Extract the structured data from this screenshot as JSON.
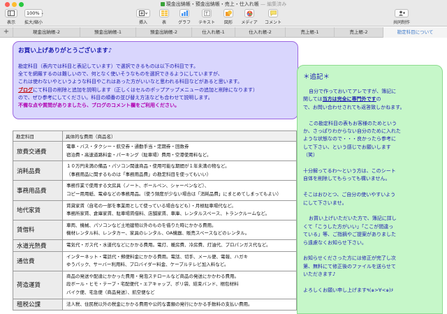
{
  "window": {
    "title": "現金出納帳・預金出納帳・売上・仕入れ帳",
    "status": "— 編集済み"
  },
  "toolbar": {
    "view_label": "表示",
    "zoom_value": "100%",
    "zoom_label": "拡大/縮小",
    "insert_label": "挿入",
    "table_label": "表",
    "chart_label": "グラフ",
    "text_label": "テキスト",
    "shape_label": "図形",
    "media_label": "メディア",
    "comment_label": "コメント",
    "collab_label": "共同制作",
    "icons": [
      "sidebar-icon",
      "plus-icon",
      "table-icon",
      "chart-icon",
      "text-icon",
      "shape-icon",
      "media-icon",
      "comment-icon",
      "collaborate-icon"
    ]
  },
  "tabs": [
    {
      "label": "現金出納帳-2"
    },
    {
      "label": "預金出納帳-1"
    },
    {
      "label": "預金出納帳-2"
    },
    {
      "label": "仕入れ帳-1"
    },
    {
      "label": "仕入れ帳-2"
    },
    {
      "label": "売上帳-1"
    },
    {
      "label": "売上帳-2"
    },
    {
      "label": "勘定科目について",
      "active": true
    }
  ],
  "thanks": {
    "title": "お買い上げありがとうございます♪",
    "lines": [
      "勘定科目（表内では科目と表記しています）で選択できるものは以下の科目です。",
      "全てを網羅するのは難しいので、何となく使いそうなものを選択できるようにしていますが、",
      "これは使わないやというような科目やこれはあった方がいいなと思われる科目などがあると思います。"
    ],
    "blog_link": "ブログ",
    "blog_line_rest": "にて科目の削除と追加を説明します（正しくはセルのポップアップメニューの追加と削除になります）",
    "line5": "ので、ぜひ参考にしてください。科目の順番の並び替え方法なども合わせて説明します。",
    "line6": "不備な点や質問がありましたら、ブログのコメント欄をご利用ください。"
  },
  "note": {
    "title": "＊追記＊",
    "p1_a": "自分で作っておいてアレですが、簿記に",
    "p1_b_pre": "関しては",
    "p1_b_bold": "当方は完全に専門外です",
    "p1_b_post": "の",
    "p1_c": "で、お問い合わせされても返答致しかねます。",
    "p2": [
      "この勘定科目の表もお客様のためという、さっぱりわからない自分のために入れたような状態なので・・・良かったら参考にして下さい、という感じでお願いします（笑）"
    ],
    "p2_lines": [
      "この勘定科目の表もお客様のためという",
      "か、さっぱりわからない自分のために入れた",
      "ような状態なので・・・良かったら参考に",
      "して下さい、という感じでお願いします",
      "（笑）"
    ],
    "p3_lines": [
      "十分解ってるわ〜という方は、このシート",
      "自体を削除してもらっても構いません。"
    ],
    "p4_lines": [
      "そこはおひとつ、ご自分の使いやすいよう",
      "にして下さいませ。"
    ],
    "p5_lines": [
      "お買い上げいただいた方で、簿記に詳し",
      "くて「こうした方がいい」「ここが間違っ",
      "ている」等、ご指摘やご提案がありました",
      "ら遠慮なくお知らせ下さい。"
    ],
    "p6_lines": [
      "お知らせくださった方には修正が完了し次",
      "第、無料にて修正後のファイルを送らせて",
      "いただきます♪"
    ],
    "p7": "よろしくお願い申し上げます٩(๑>∀<๑)۶"
  },
  "table": {
    "headers": [
      "勘定科目",
      "具体的な費用（商品名）"
    ],
    "rows": [
      {
        "cat": "旅費交通費",
        "lines": [
          "電車・バス・タクシー・航空券・通勤手当・定期券・回数券",
          "宿泊費・高速道路料金・パーキング（駐車場）費用・空港使用料など。"
        ]
      },
      {
        "cat": "消耗品費",
        "lines": [
          "１０万円未満の備品・パソコン関連商品・使用可能な期間が１年未満の物など。",
          "（事務用品に関するものは「事務用品費」の勘定科目を使ってもいい）"
        ]
      },
      {
        "cat": "事務用品費",
        "lines": [
          "事務作業で使用する文房具（ノート、ボールペン、シャーペンなど）、",
          "コピー用用紙、電卓などの事務用品。（使う頻度が少ない場合は「消耗品費」にまとめてしまってもよい）"
        ]
      },
      {
        "cat": "地代家賃",
        "lines": [
          "賃貸家賃（自宅の一部を事業用として使っている場合なども）・月極駐車場代など。",
          "事務所家賃、倉庫家賃、駐車場賃借料、店舗家賃、車庫、レンタルスペース、トランクルームなど。"
        ]
      },
      {
        "cat": "賃借料",
        "lines": [
          "車両、機械、パソコンなど土地建物以外のものを借りた時にかかる費用。",
          "機材レンタル料、レンタカー、家具のレンタル、OA機器、販売スペースなどのレンタル。"
        ]
      },
      {
        "cat": "水道光熱費",
        "lines": [
          "電気代・ガス代・水道代などにかかる費用。電灯、暖房費、冷房費、灯油代、プロパンガス代など。"
        ]
      },
      {
        "cat": "通信費",
        "lines": [
          "インターネット・電話代・郵便料金にかかる費用。電話、切手、メール便、電報、ハガキ",
          "ゆうパック、サーバー利用料、プロバイダー料金、ケーブルテレビ加入料など。"
        ]
      },
      {
        "cat": "荷造運賃",
        "lines": [
          "商品の発送や配達にかかった費用・発泡スチロールなど商品の発送にかかわる費用。",
          "段ボール・ヒモ・テープ・宅配便代・エアキャップ、ポリ袋、結束バンド、梱包材料",
          "バイク便、宅急便（商品発送）、航空便など"
        ]
      },
      {
        "cat": "租税公課",
        "lines": [
          "法人税、住民税以外の税金にかかる費用や公的な書類の発行にかかる手数料の支払い費用。"
        ]
      }
    ]
  }
}
